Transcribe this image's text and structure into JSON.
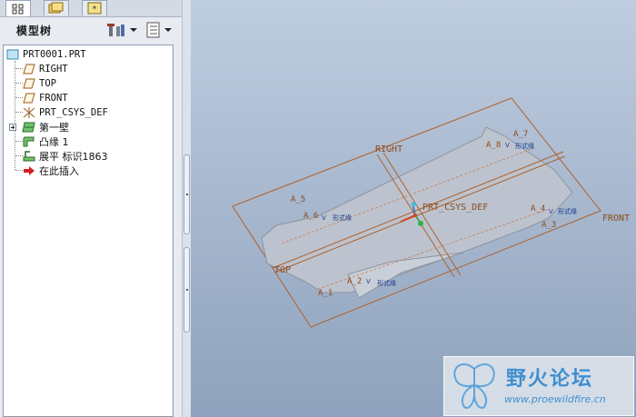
{
  "navigator": {
    "tabs": [
      {
        "icon": "model-tree-tab-icon",
        "active": true
      },
      {
        "icon": "folder-browser-tab-icon",
        "active": false
      },
      {
        "icon": "favorites-tab-icon",
        "active": false
      }
    ],
    "title": "模型树",
    "toolbar": [
      {
        "icon": "settings-tools-icon"
      },
      {
        "icon": "show-list-icon"
      }
    ],
    "tree": [
      {
        "label": "PRT0001.PRT",
        "icon": "part-icon",
        "level": 0
      },
      {
        "label": "RIGHT",
        "icon": "datum-plane-icon",
        "level": 1
      },
      {
        "label": "TOP",
        "icon": "datum-plane-icon",
        "level": 1
      },
      {
        "label": "FRONT",
        "icon": "datum-plane-icon",
        "level": 1
      },
      {
        "label": "PRT_CSYS_DEF",
        "icon": "coordinate-system-icon",
        "level": 1
      },
      {
        "label": "第一壁",
        "icon": "first-wall-icon",
        "level": 1,
        "expandable": true
      },
      {
        "label": "凸缘 1",
        "icon": "flange-icon",
        "level": 1
      },
      {
        "label": "展平 标识1863",
        "icon": "unbend-icon",
        "level": 1
      },
      {
        "label": "在此插入",
        "icon": "insert-here-arrow-icon",
        "level": 1
      }
    ]
  },
  "viewport": {
    "planes": {
      "right": "RIGHT",
      "top": "TOP",
      "front": "FRONT"
    },
    "csys": "PRT_CSYS_DEF",
    "axes": [
      "A_1",
      "A_2",
      "A_3",
      "A_4",
      "A_5",
      "A_6",
      "A_7",
      "A_8"
    ],
    "tag": "形式缘"
  },
  "watermark": {
    "title": "野火论坛",
    "url": "www.proewildfire.cn"
  },
  "colors": {
    "datum": "#b0612a",
    "part_fill": "#bcc3cf",
    "axis_blue": "#1a3b8f",
    "csys": "#d0461f"
  }
}
